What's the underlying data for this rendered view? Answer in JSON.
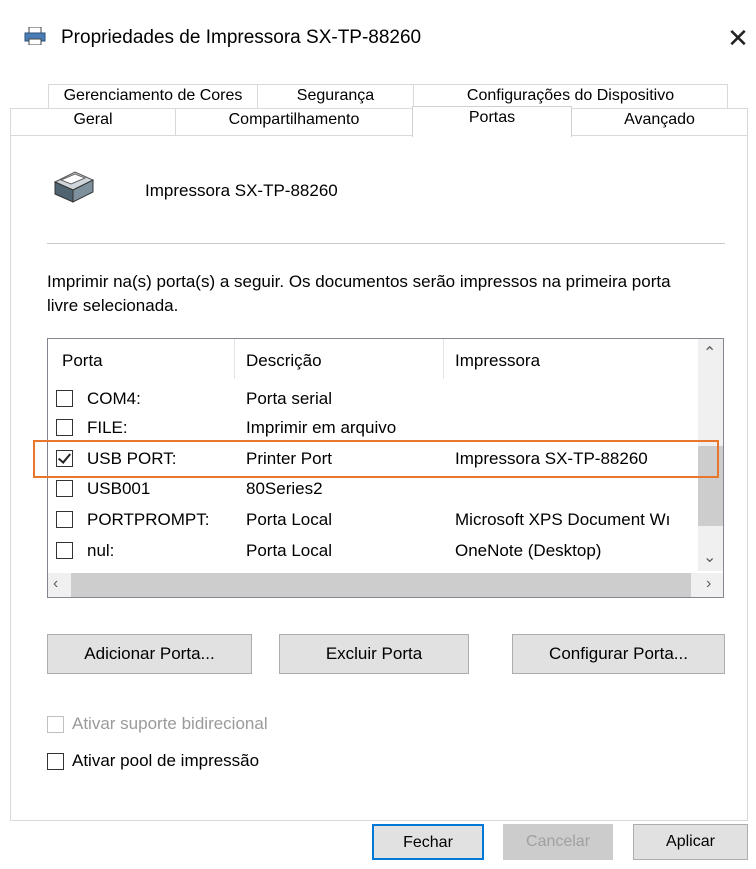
{
  "window": {
    "title": "Propriedades de Impressora SX-TP-88260",
    "close_label": "✕"
  },
  "tabs_row1": [
    "Gerenciamento de Cores",
    "Segurança",
    "Configurações do Dispositivo"
  ],
  "tabs_row2": [
    "Geral",
    "Compartilhamento",
    "Portas",
    "Avançado"
  ],
  "active_tab": "Portas",
  "printer": {
    "name": "Impressora SX-TP-88260",
    "icon": "printer-icon"
  },
  "instructions": "Imprimir na(s) porta(s) a seguir. Os documentos serão impressos na primeira porta livre selecionada.",
  "ports": {
    "columns": [
      "Porta",
      "Descrição",
      "Impressora"
    ],
    "rows": [
      {
        "port": "COM4:",
        "description": "Porta serial",
        "printer": "",
        "checked": false
      },
      {
        "port": "FILE:",
        "description": "Imprimir em arquivo",
        "printer": "",
        "checked": false
      },
      {
        "port": "USB PORT:",
        "description": "Printer Port",
        "printer": "Impressora SX-TP-88260",
        "checked": true
      },
      {
        "port": "USB001",
        "description": "80Series2",
        "printer": "",
        "checked": false
      },
      {
        "port": "PORTPROMPT:",
        "description": "Porta Local",
        "printer": "Microsoft XPS Document Wı",
        "checked": false
      },
      {
        "port": "nul:",
        "description": "Porta Local",
        "printer": "OneNote (Desktop)",
        "checked": false
      }
    ],
    "highlight_color": "#e8762d"
  },
  "port_buttons": {
    "add": "Adicionar Porta...",
    "delete": "Excluir Porta",
    "configure": "Configurar Porta..."
  },
  "options": {
    "bidirectional": {
      "label": "Ativar suporte bidirecional",
      "checked": false,
      "enabled": false
    },
    "pooling": {
      "label": "Ativar pool de impressão",
      "checked": false,
      "enabled": true
    }
  },
  "footer_buttons": {
    "close": "Fechar",
    "cancel": "Cancelar",
    "apply": "Aplicar"
  },
  "colors": {
    "accent": "#0078d7",
    "highlight": "#e8762d"
  }
}
